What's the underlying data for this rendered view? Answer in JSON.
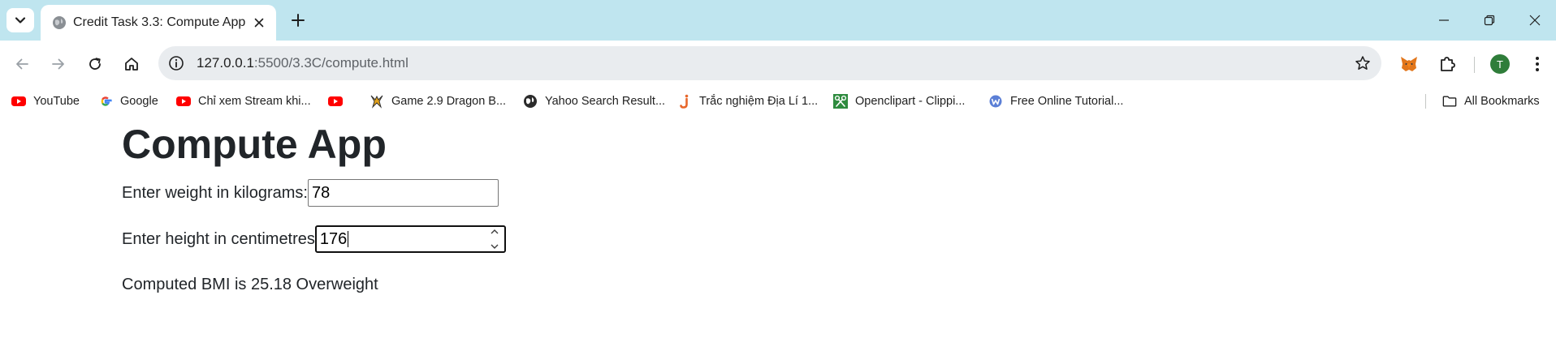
{
  "browser": {
    "tab": {
      "title": "Credit Task 3.3: Compute App"
    },
    "url": {
      "host": "127.0.0.1",
      "rest": ":5500/3.3C/compute.html"
    },
    "profile_initial": "T"
  },
  "bookmarks": [
    {
      "label": "YouTube",
      "icon": "youtube-icon"
    },
    {
      "label": "Google",
      "icon": "google-icon"
    },
    {
      "label": "Chỉ xem Stream khi...",
      "icon": "youtube-icon"
    },
    {
      "label": "",
      "icon": "youtube-icon"
    },
    {
      "label": "Game 2.9 Dragon B...",
      "icon": "dragon-game-icon"
    },
    {
      "label": "Yahoo Search Result...",
      "icon": "globe-icon"
    },
    {
      "label": "Trắc nghiệm Địa Lí 1...",
      "icon": "j-site-icon"
    },
    {
      "label": "Openclipart - Clippi...",
      "icon": "openclipart-icon"
    },
    {
      "label": "Free Online Tutorial...",
      "icon": "tutorial-site-icon"
    }
  ],
  "all_bookmarks_label": "All Bookmarks",
  "app": {
    "title": "Compute App",
    "weight": {
      "label": "Enter weight in kilograms:",
      "value": "78"
    },
    "height": {
      "label": "Enter height in centimetres",
      "value": "176"
    },
    "result": "Computed BMI is 25.18 Overweight"
  },
  "colors": {
    "tabstrip": "#bfe5ef",
    "omnibox": "#e9ecef",
    "text": "#212529",
    "avatar": "#2f7d3a",
    "youtube_red": "#ff0000"
  }
}
